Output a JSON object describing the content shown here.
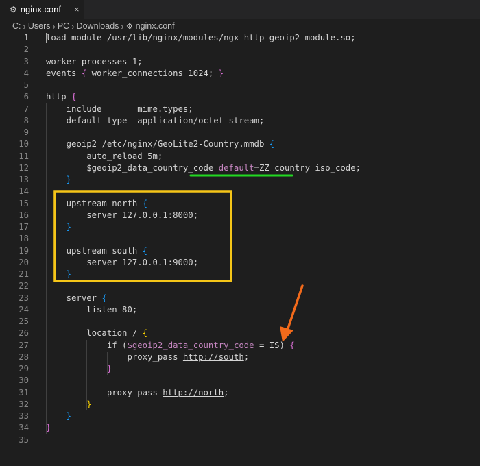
{
  "tab": {
    "icon": "gear-icon",
    "title": "nginx.conf",
    "close": "×"
  },
  "breadcrumb": {
    "parts": [
      "C:",
      "Users",
      "PC",
      "Downloads"
    ],
    "file_icon": "gear-icon",
    "file": "nginx.conf"
  },
  "editor": {
    "active_line": 1,
    "lines": [
      {
        "n": "1",
        "segs": [
          [
            "",
            "load_module /usr/lib/nginx/modules/ngx_http_geoip2_module.so;"
          ]
        ]
      },
      {
        "n": "2",
        "segs": []
      },
      {
        "n": "3",
        "segs": [
          [
            "",
            "worker_processes 1;"
          ]
        ]
      },
      {
        "n": "4",
        "segs": [
          [
            "",
            "events "
          ],
          [
            "p",
            "{"
          ],
          [
            "",
            " worker_connections 1024; "
          ],
          [
            "p",
            "}"
          ]
        ]
      },
      {
        "n": "5",
        "segs": []
      },
      {
        "n": "6",
        "segs": [
          [
            "",
            "http "
          ],
          [
            "p",
            "{"
          ]
        ]
      },
      {
        "n": "7",
        "segs": [
          [
            "",
            "    include       mime.types;"
          ]
        ]
      },
      {
        "n": "8",
        "segs": [
          [
            "",
            "    default_type  application/octet-stream;"
          ]
        ]
      },
      {
        "n": "9",
        "segs": []
      },
      {
        "n": "10",
        "segs": [
          [
            "",
            "    geoip2 /etc/nginx/GeoLite2-Country.mmdb "
          ],
          [
            "b",
            "{"
          ]
        ]
      },
      {
        "n": "11",
        "segs": [
          [
            "",
            "        auto_reload 5m;"
          ]
        ]
      },
      {
        "n": "12",
        "segs": [
          [
            "",
            "        $geoip2_data_country_code "
          ],
          [
            "kw",
            "default"
          ],
          [
            "",
            "=ZZ country iso_code;"
          ]
        ]
      },
      {
        "n": "13",
        "segs": [
          [
            "",
            "    "
          ],
          [
            "b",
            "}"
          ]
        ]
      },
      {
        "n": "14",
        "segs": []
      },
      {
        "n": "15",
        "segs": [
          [
            "",
            "    upstream north "
          ],
          [
            "b",
            "{"
          ]
        ]
      },
      {
        "n": "16",
        "segs": [
          [
            "",
            "        server 127.0.0.1:8000;"
          ]
        ]
      },
      {
        "n": "17",
        "segs": [
          [
            "",
            "    "
          ],
          [
            "b",
            "}"
          ]
        ]
      },
      {
        "n": "18",
        "segs": []
      },
      {
        "n": "19",
        "segs": [
          [
            "",
            "    upstream south "
          ],
          [
            "b",
            "{"
          ]
        ]
      },
      {
        "n": "20",
        "segs": [
          [
            "",
            "        server 127.0.0.1:9000;"
          ]
        ]
      },
      {
        "n": "21",
        "segs": [
          [
            "",
            "    "
          ],
          [
            "b",
            "}"
          ]
        ]
      },
      {
        "n": "22",
        "segs": []
      },
      {
        "n": "23",
        "segs": [
          [
            "",
            "    server "
          ],
          [
            "b",
            "{"
          ]
        ]
      },
      {
        "n": "24",
        "segs": [
          [
            "",
            "        listen 80;"
          ]
        ]
      },
      {
        "n": "25",
        "segs": []
      },
      {
        "n": "26",
        "segs": [
          [
            "",
            "        location / "
          ],
          [
            "y",
            "{"
          ]
        ]
      },
      {
        "n": "27",
        "segs": [
          [
            "",
            "            if ("
          ],
          [
            "var",
            "$geoip2_data_country_code"
          ],
          [
            "",
            " = IS) "
          ],
          [
            "p",
            "{"
          ]
        ]
      },
      {
        "n": "28",
        "segs": [
          [
            "",
            "                proxy_pass "
          ],
          [
            "ul",
            "http://south"
          ],
          [
            "",
            ";"
          ]
        ]
      },
      {
        "n": "29",
        "segs": [
          [
            "",
            "            "
          ],
          [
            "p",
            "}"
          ]
        ]
      },
      {
        "n": "30",
        "segs": []
      },
      {
        "n": "31",
        "segs": [
          [
            "",
            "            proxy_pass "
          ],
          [
            "ul",
            "http://north"
          ],
          [
            "",
            ";"
          ]
        ]
      },
      {
        "n": "32",
        "segs": [
          [
            "",
            "        "
          ],
          [
            "y",
            "}"
          ]
        ]
      },
      {
        "n": "33",
        "segs": [
          [
            "",
            "    "
          ],
          [
            "b",
            "}"
          ]
        ]
      },
      {
        "n": "34",
        "segs": [
          [
            "p",
            "}"
          ]
        ]
      },
      {
        "n": "35",
        "segs": []
      }
    ]
  },
  "annotations": {
    "underline_color": "#22d822",
    "box_color": "#f5c518",
    "arrow_color": "#f26a1b"
  }
}
